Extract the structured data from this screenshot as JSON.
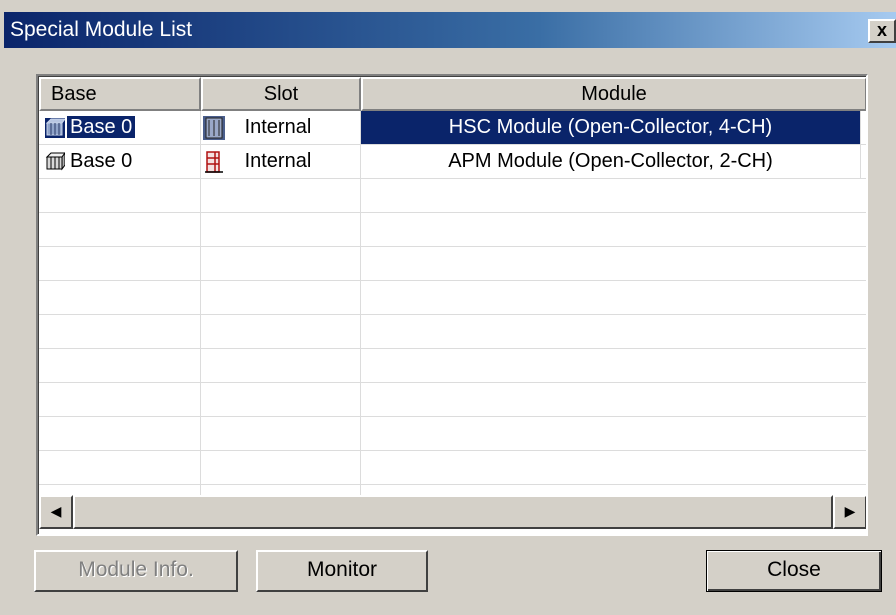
{
  "window": {
    "title": "Special Module List",
    "close_glyph": "x"
  },
  "list": {
    "columns": [
      "Base",
      "Slot",
      "Module"
    ],
    "rows": [
      {
        "base": "Base 0",
        "base_icon": "base-module-icon",
        "slot": "Internal",
        "slot_icon": "slot-module-icon",
        "module": "HSC Module (Open-Collector, 4-CH)",
        "selected": true
      },
      {
        "base": "Base 0",
        "base_icon": "base-module-icon",
        "slot": "Internal",
        "slot_icon": "slot-module-icon",
        "module": "APM Module (Open-Collector, 2-CH)",
        "selected": false
      }
    ]
  },
  "scrollbar": {
    "left_arrow": "◀",
    "right_arrow": "▶"
  },
  "buttons": {
    "module_info": "Module Info.",
    "monitor": "Monitor",
    "close": "Close"
  },
  "colors": {
    "selection": "#0a246a",
    "face": "#d4d0c8"
  }
}
